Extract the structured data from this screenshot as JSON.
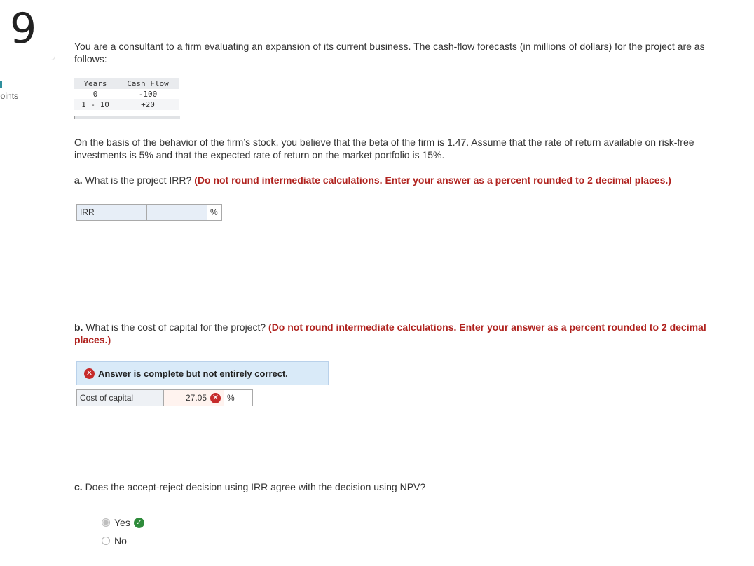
{
  "question": {
    "number": "9",
    "points_label": "points"
  },
  "intro": "You are a consultant to a firm evaluating an expansion of its current business. The cash-flow forecasts (in millions of dollars) for the project are as follows:",
  "cash_flow_table": {
    "headers": [
      "Years",
      "Cash Flow"
    ],
    "rows": [
      {
        "year": "0",
        "cash_flow": "-100"
      },
      {
        "year": "1 - 10",
        "cash_flow": "+20"
      }
    ]
  },
  "context": "On the basis of the behavior of the firm’s stock, you believe that the beta of the firm is 1.47. Assume that the rate of return available on risk-free investments is 5% and that the expected rate of return on the market portfolio is 15%.",
  "part_a": {
    "label": "a.",
    "question": "What is the project IRR?",
    "instruction": "(Do not round intermediate calculations. Enter your answer as a percent rounded to 2 decimal places.)",
    "field_label": "IRR",
    "value": "",
    "unit": "%"
  },
  "part_b": {
    "label": "b.",
    "question": "What is the cost of capital for the project?",
    "instruction": "(Do not round intermediate calculations. Enter your answer as a percent rounded to 2 decimal places.)",
    "banner": "Answer is complete but not entirely correct.",
    "field_label": "Cost of capital",
    "value": "27.05",
    "unit": "%",
    "status": "incorrect"
  },
  "part_c": {
    "label": "c.",
    "question": "Does the accept-reject decision using IRR agree with the decision using NPV?",
    "options": [
      {
        "label": "Yes",
        "selected": true,
        "status": "correct"
      },
      {
        "label": "No",
        "selected": false
      }
    ]
  },
  "colors": {
    "instruction_red": "#b0231f",
    "incorrect_red": "#c62b2b",
    "correct_green": "#2e8b3a",
    "banner_blue": "#d9eaf8"
  }
}
